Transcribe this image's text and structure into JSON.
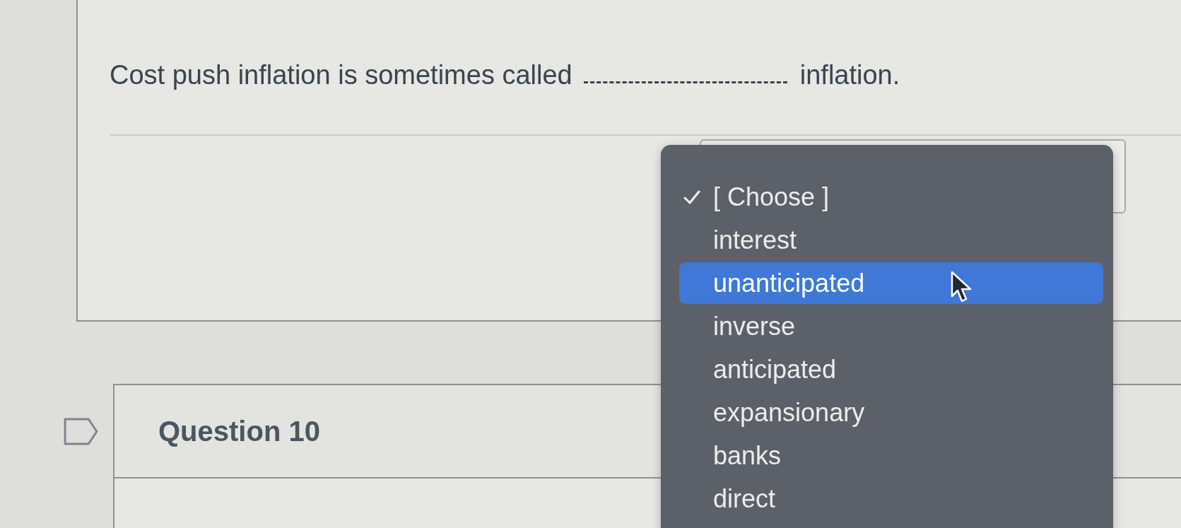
{
  "question": {
    "text_before": "Cost push inflation is sometimes called",
    "text_after": "inflation."
  },
  "dropdown": {
    "options": [
      {
        "label": "[ Choose ]",
        "selected": true,
        "highlighted": false
      },
      {
        "label": "interest",
        "selected": false,
        "highlighted": false
      },
      {
        "label": "unanticipated",
        "selected": false,
        "highlighted": true
      },
      {
        "label": "inverse",
        "selected": false,
        "highlighted": false
      },
      {
        "label": "anticipated",
        "selected": false,
        "highlighted": false
      },
      {
        "label": "expansionary",
        "selected": false,
        "highlighted": false
      },
      {
        "label": "banks",
        "selected": false,
        "highlighted": false
      },
      {
        "label": "direct",
        "selected": false,
        "highlighted": false
      }
    ]
  },
  "next_question": {
    "title": "Question 10"
  }
}
